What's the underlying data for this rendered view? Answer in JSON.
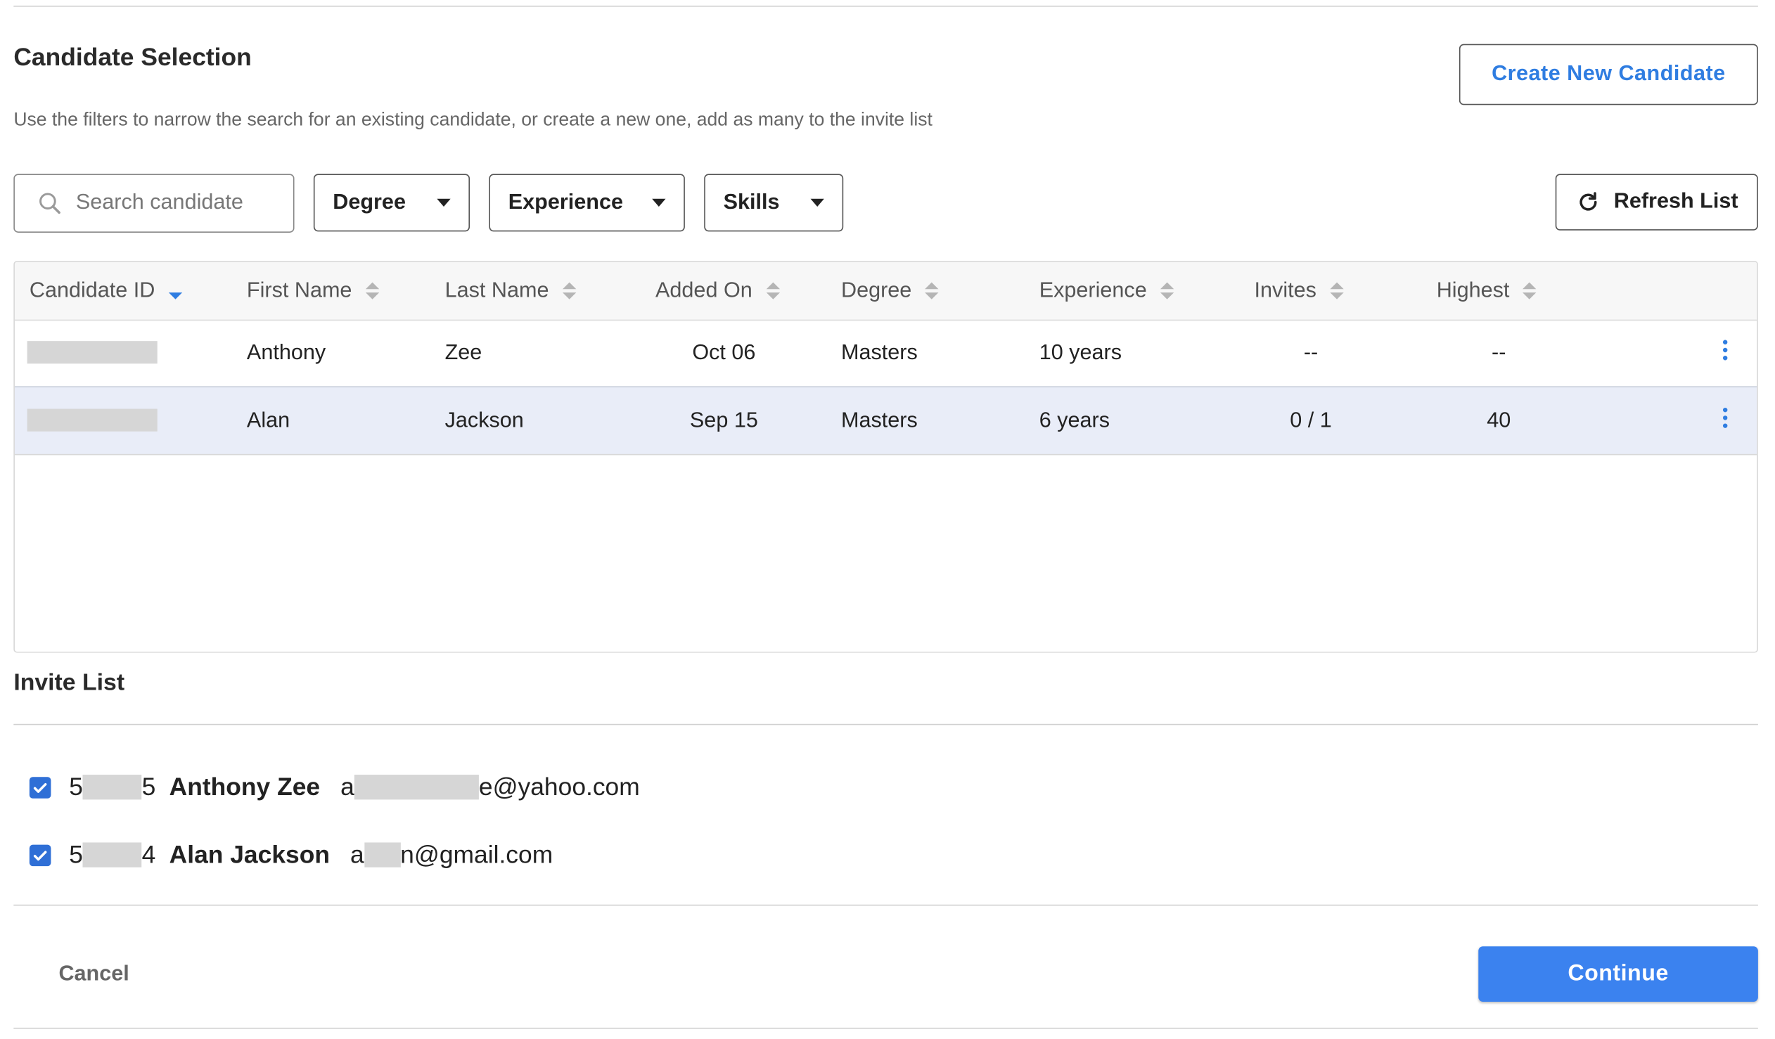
{
  "header": {
    "title": "Candidate Selection",
    "subtitle": "Use the filters to narrow the search for an existing candidate, or create a new one, add as many to the invite list",
    "create_button": "Create New Candidate"
  },
  "filters": {
    "search_placeholder": "Search candidate",
    "degree": "Degree",
    "experience": "Experience",
    "skills": "Skills",
    "refresh_button": "Refresh List"
  },
  "table": {
    "columns": [
      "Candidate ID",
      "First Name",
      "Last Name",
      "Added On",
      "Degree",
      "Experience",
      "Invites",
      "Highest"
    ],
    "sorted_column": "Candidate ID",
    "rows": [
      {
        "first_name": "Anthony",
        "last_name": "Zee",
        "added_on": "Oct 06",
        "degree": "Masters",
        "experience": "10 years",
        "invites": "--",
        "highest": "--",
        "selected": false
      },
      {
        "first_name": "Alan",
        "last_name": "Jackson",
        "added_on": "Sep 15",
        "degree": "Masters",
        "experience": "6 years",
        "invites": "0 / 1",
        "highest": "40",
        "selected": true
      }
    ]
  },
  "invite_list": {
    "title": "Invite List",
    "items": [
      {
        "id_prefix": "5",
        "id_suffix": "5",
        "name": "Anthony Zee",
        "email_prefix": "a",
        "email_domain": "e@yahoo.com",
        "checked": true
      },
      {
        "id_prefix": "5",
        "id_suffix": "4",
        "name": "Alan Jackson",
        "email_prefix": "a",
        "email_domain": "n@gmail.com",
        "checked": true
      }
    ]
  },
  "footer": {
    "cancel": "Cancel",
    "continue": "Continue"
  },
  "colors": {
    "accent": "#2f7de1",
    "primary_button": "#3b82ef",
    "selected_row": "#e9edf8"
  }
}
